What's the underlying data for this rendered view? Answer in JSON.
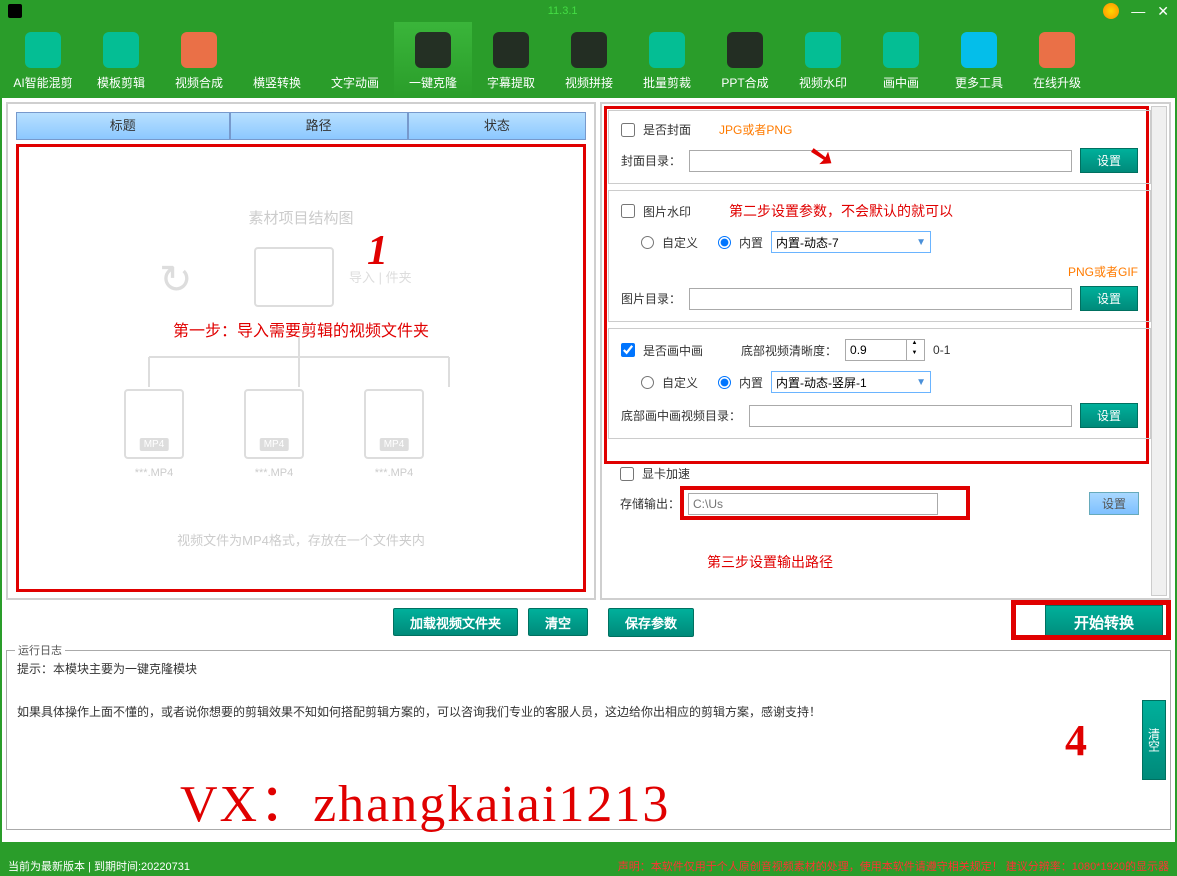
{
  "titlebar": {
    "version": "11.3.1"
  },
  "toolbar": {
    "items": [
      {
        "label": "AI智能混剪",
        "color": "#00c2a0"
      },
      {
        "label": "模板剪辑",
        "color": "#00c2a0"
      },
      {
        "label": "视频合成",
        "color": "#ff6b4a"
      },
      {
        "label": "横竖转换",
        "color": "#2a9d2a"
      },
      {
        "label": "文字动画",
        "color": "#2a9d2a"
      },
      {
        "label": "一键克隆",
        "color": "#222",
        "active": true
      },
      {
        "label": "字幕提取",
        "color": "#222"
      },
      {
        "label": "视频拼接",
        "color": "#222"
      },
      {
        "label": "批量剪裁",
        "color": "#00c2a0"
      },
      {
        "label": "PPT合成",
        "color": "#222"
      },
      {
        "label": "视频水印",
        "color": "#00c2a0"
      },
      {
        "label": "画中画",
        "color": "#00c2a0"
      },
      {
        "label": "更多工具",
        "color": "#00c2ff"
      },
      {
        "label": "在线升级",
        "color": "#ff6b4a"
      }
    ]
  },
  "file_header": {
    "col1": "标题",
    "col2": "路径",
    "col3": "状态"
  },
  "diagram": {
    "title": "素材项目结构图",
    "import_label": "导入 | 件夹",
    "step1": "第一步：导入需要剪辑的视频文件夹",
    "mp4_label": "***.MP4",
    "note": "视频文件为MP4格式，存放在一个文件夹内"
  },
  "left_buttons": {
    "load": "加载视频文件夹",
    "clear": "清空"
  },
  "right": {
    "section1": {
      "chk_cover": "是否封面",
      "jpg_note": "JPG或者PNG",
      "cover_dir_lbl": "封面目录：",
      "set_btn": "设置"
    },
    "section2": {
      "chk_watermark": "图片水印",
      "step2_note": "第二步设置参数，不会默认的就可以",
      "rdo_custom": "自定义",
      "rdo_builtin": "内置",
      "combo_val": "内置-动态-7",
      "png_note": "PNG或者GIF",
      "img_dir_lbl": "图片目录：",
      "set_btn": "设置"
    },
    "section3": {
      "chk_pip": "是否画中画",
      "clarity_lbl": "底部视频清晰度：",
      "clarity_val": "0.9",
      "clarity_range": "0-1",
      "rdo_custom": "自定义",
      "rdo_builtin": "内置",
      "combo_val": "内置-动态-竖屏-1",
      "pip_dir_lbl": "底部画中画视频目录：",
      "set_btn": "设置"
    },
    "section4": {
      "chk_gpu": "显卡加速",
      "out_lbl": "存储输出：",
      "out_placeholder": "C:\\Us",
      "step3_txt": "第三步设置输出路径",
      "set_btn": "设置"
    }
  },
  "right_buttons": {
    "save": "保存参数",
    "start": "开始转换"
  },
  "log": {
    "title": "运行日志",
    "line1": "提示：本模块主要为一键克隆模块",
    "line2": "如果具体操作上面不懂的，或者说你想要的剪辑效果不知如何搭配剪辑方案的，可以咨询我们专业的客服人员，这边给你出相应的剪辑方案，感谢支持！",
    "clear": "清空"
  },
  "overlay": {
    "vx": "VX：zhangkaiai1213"
  },
  "statusbar": {
    "left": "当前为最新版本 | 到期时间:20220731",
    "right": "声明：本软件仅用于个人原创音视频素材的处理，使用本软件请遵守相关规定！  建议分辨率：1080*1920的显示器"
  }
}
